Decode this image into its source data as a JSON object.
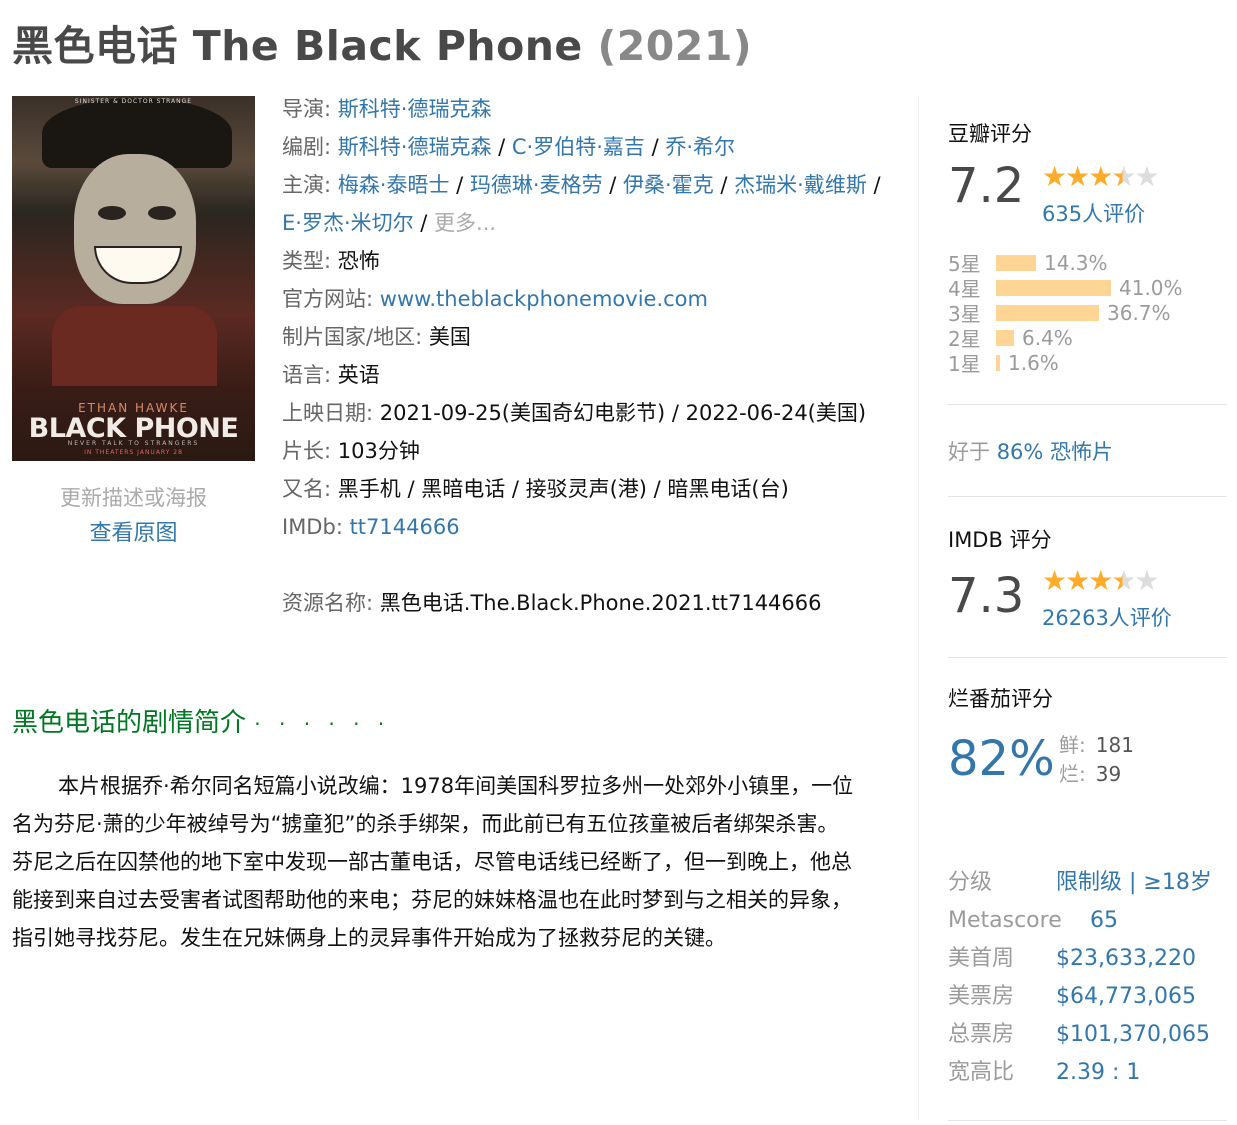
{
  "header": {
    "title_cn": "黑色电话",
    "title_en": "The Black Phone",
    "year": "(2021)"
  },
  "poster": {
    "tag_top": "SINISTER & DOCTOR STRANGE",
    "actor": "ETHAN HAWKE",
    "movie_title": "BLACK PHONE",
    "tagline": "NEVER TALK TO STRANGERS",
    "release_line": "IN THEATERS JANUARY 28",
    "update_link": "更新描述或海报",
    "view_original": "查看原图"
  },
  "info": {
    "director_label": "导演",
    "directors": [
      "斯科特·德瑞克森"
    ],
    "writer_label": "编剧",
    "writers": [
      "斯科特·德瑞克森",
      "C·罗伯特·嘉吉",
      "乔·希尔"
    ],
    "cast_label": "主演",
    "cast": [
      "梅森·泰晤士",
      "玛德琳·麦格劳",
      "伊桑·霍克",
      "杰瑞米·戴维斯",
      "E·罗杰·米切尔"
    ],
    "cast_more": "更多...",
    "genre_label": "类型",
    "genre": "恐怖",
    "site_label": "官方网站",
    "site": "www.theblackphonemovie.com",
    "country_label": "制片国家/地区",
    "country": "美国",
    "language_label": "语言",
    "language": "英语",
    "release_label": "上映日期",
    "release_1": "2021-09-25(美国奇幻电影节)",
    "release_2": "2022-06-24(美国)",
    "runtime_label": "片长",
    "runtime": "103分钟",
    "aka_label": "又名",
    "aka": "黑手机 / 黑暗电话 / 接驳灵声(港) / 暗黑电话(台)",
    "imdb_label": "IMDb",
    "imdb": "tt7144666",
    "resource_label": "资源名称",
    "resource": "黑色电话.The.Black.Phone.2021.tt7144666"
  },
  "synopsis": {
    "heading": "黑色电话的剧情简介",
    "dots": "· · · · · ·",
    "text": "本片根据乔·希尔同名短篇小说改编：1978年间美国科罗拉多州一处郊外小镇里，一位名为芬尼·萧的少年被绰号为“掳童犯”的杀手绑架，而此前已有五位孩童被后者绑架杀害。芬尼之后在囚禁他的地下室中发现一部古董电话，尽管电话线已经断了，但一到晚上，他总能接到来自过去受害者试图帮助他的来电；芬尼的妹妹格温也在此时梦到与之相关的异象，指引她寻找芬尼。发生在兄妹俩身上的灵异事件开始成为了拯救芬尼的关键。"
  },
  "douban": {
    "heading": "豆瓣评分",
    "score": "7.2",
    "stars_filled": 3.5,
    "stars_text_on": "★★★",
    "stars_text_half": "★",
    "stars_text_off": "★",
    "count": "635人评价",
    "distribution": [
      {
        "label": "5星",
        "percent": 14.3,
        "text": "14.3%"
      },
      {
        "label": "4星",
        "percent": 41.0,
        "text": "41.0%"
      },
      {
        "label": "3星",
        "percent": 36.7,
        "text": "36.7%"
      },
      {
        "label": "2星",
        "percent": 6.4,
        "text": "6.4%"
      },
      {
        "label": "1星",
        "percent": 1.6,
        "text": "1.6%"
      }
    ],
    "better_prefix": "好于",
    "better_value": "86% 恐怖片"
  },
  "imdb_rating": {
    "heading": "IMDB 评分",
    "score": "7.3",
    "stars_filled": 3.5,
    "count": "26263人评价"
  },
  "rotten": {
    "heading": "烂番茄评分",
    "score": "82%",
    "fresh_label": "鲜:",
    "fresh": "181",
    "rotten_label": "烂:",
    "rotten": "39"
  },
  "meta": {
    "rating_label": "分级",
    "rating": "限制级 | ≥18岁",
    "metascore_label": "Metascore",
    "metascore": "65",
    "us_opening_label": "美首周",
    "us_opening": "$23,633,220",
    "us_gross_label": "美票房",
    "us_gross": "$64,773,065",
    "world_gross_label": "总票房",
    "world_gross": "$101,370,065",
    "aspect_label": "宽高比",
    "aspect": "2.39 : 1"
  },
  "colors": {
    "link": "#3377aa",
    "star": "#ffac2d",
    "bar": "#ffd596",
    "green": "#007722"
  }
}
